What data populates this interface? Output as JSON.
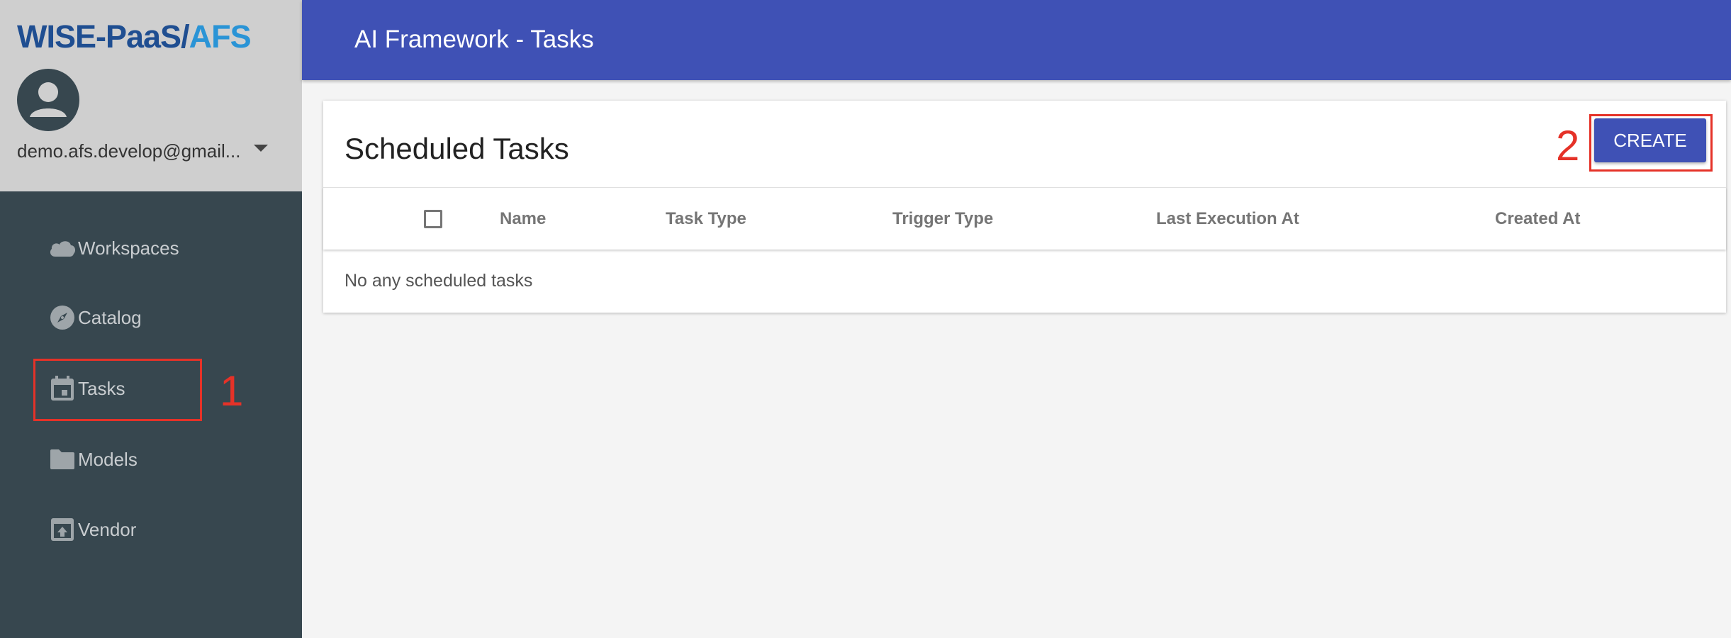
{
  "brand": {
    "part1": "WISE-PaaS/",
    "part2": "AFS"
  },
  "user": {
    "email": "demo.afs.develop@gmail..."
  },
  "sidebar": {
    "items": [
      {
        "label": "Workspaces",
        "icon": "cloud-icon"
      },
      {
        "label": "Catalog",
        "icon": "compass-icon"
      },
      {
        "label": "Tasks",
        "icon": "calendar-icon"
      },
      {
        "label": "Models",
        "icon": "folder-icon"
      },
      {
        "label": "Vendor",
        "icon": "upload-box-icon"
      }
    ]
  },
  "header": {
    "title": "AI Framework - Tasks"
  },
  "main": {
    "title": "Scheduled Tasks",
    "create_label": "CREATE",
    "columns": [
      "Name",
      "Task Type",
      "Trigger Type",
      "Last Execution At",
      "Created At"
    ],
    "empty_message": "No any scheduled tasks"
  },
  "annotations": [
    "1",
    "2"
  ],
  "colors": {
    "sidebar": "#37474f",
    "primary": "#3f51b5",
    "annotation": "#e53228",
    "brand_dark": "#1f4e91",
    "brand_light": "#2a94d6"
  }
}
